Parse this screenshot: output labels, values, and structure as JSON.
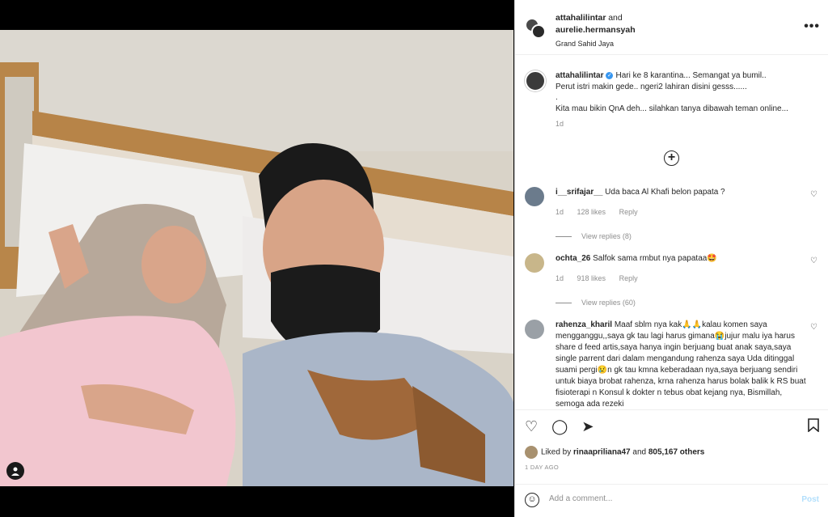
{
  "header": {
    "user1": "attahalilintar",
    "conj": "and",
    "user2": "aurelie.hermansyah",
    "location": "Grand Sahid Jaya",
    "more": "•••"
  },
  "caption": {
    "username": "attahalilintar",
    "verified": "✓",
    "line1": "Hari ke 8 karantina... Semangat ya bumil..",
    "line2": "Perut istri makin gede.. ngeri2 lahiran disini gesss......",
    "line3": ".",
    "line4": "Kita mau bikin QnA deh... silahkan tanya dibawah teman online...",
    "time": "1d"
  },
  "load_more": "+",
  "comments": [
    {
      "username": "i__srifajar__",
      "text": "Uda baca Al Khafi belon papata ?",
      "time": "1d",
      "likes": "128 likes",
      "reply": "Reply",
      "replies": "View replies (8)"
    },
    {
      "username": "ochta_26",
      "text": "Salfok sama rmbut nya papataa🤩",
      "time": "1d",
      "likes": "918 likes",
      "reply": "Reply",
      "replies": "View replies (60)"
    },
    {
      "username": "rahenza_kharil",
      "text": "Maaf sblm nya kak🙏🙏kalau komen saya mengganggu,,saya gk tau lagi harus gimana😭jujur malu iya harus share d feed artis,saya hanya ingin berjuang buat anak saya,saya single parrent dari dalam mengandung rahenza saya Uda ditinggal suami pergi😢n gk tau kmna keberadaan nya,saya berjuang sendiri untuk biaya brobat rahenza, krna rahenza harus bolak balik k RS buat fisioterapi n Konsul k dokter n tebus obat kejang nya, Bismillah, semoga ada rezeki"
    }
  ],
  "icons": {
    "heart": "♡",
    "comment": "◯",
    "share": "➤",
    "bookmark": "🔖"
  },
  "likes": {
    "prefix": "Liked by",
    "user": "rinaapriliana47",
    "and": "and",
    "count": "805,167 others"
  },
  "date": "1 DAY AGO",
  "add_comment": {
    "placeholder": "Add a comment...",
    "post": "Post"
  }
}
